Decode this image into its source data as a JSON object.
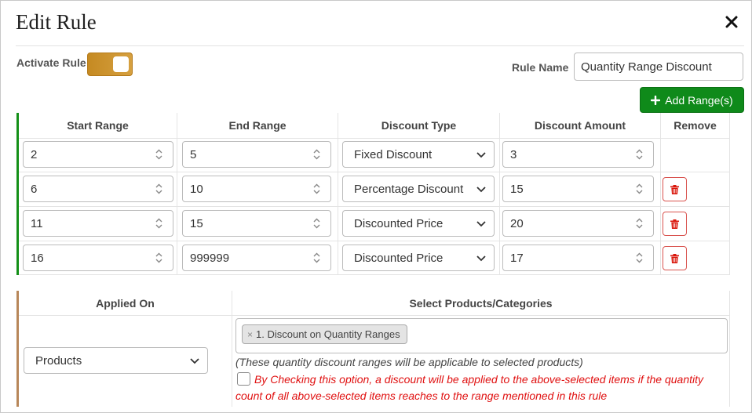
{
  "modal": {
    "title": "Edit Rule"
  },
  "activate": {
    "label": "Activate Rule",
    "enabled": true
  },
  "rule_name": {
    "label": "Rule Name",
    "value": "Quantity Range Discount"
  },
  "add_button": {
    "label": "Add Range(s)",
    "icon": "plus-icon"
  },
  "ranges": {
    "headers": [
      "Start Range",
      "End Range",
      "Discount Type",
      "Discount Amount",
      "Remove"
    ],
    "rows": [
      {
        "start": "2",
        "end": "5",
        "type": "Fixed Discount",
        "amount": "3",
        "removable": false
      },
      {
        "start": "6",
        "end": "10",
        "type": "Percentage Discount",
        "amount": "15",
        "removable": true
      },
      {
        "start": "11",
        "end": "15",
        "type": "Discounted Price",
        "amount": "20",
        "removable": true
      },
      {
        "start": "16",
        "end": "999999",
        "type": "Discounted Price",
        "amount": "17",
        "removable": true
      }
    ]
  },
  "applied": {
    "headers": [
      "Applied On",
      "Select Products/Categories"
    ],
    "applied_on": "Products",
    "selected_items": [
      "1. Discount on Quantity Ranges"
    ],
    "chip_remove": "×",
    "note": "(These quantity discount ranges will be applicable to selected products)",
    "checkbox_text": "By Checking this option, a discount will be applied to the above-selected items if the quantity count of all above-selected items reaches to the range mentioned in this rule",
    "checkbox_checked": false
  },
  "colors": {
    "primary_green": "#0f8a1a",
    "toggle_orange": "#c58a22",
    "ranges_accent": "#149018",
    "applied_accent": "#b8875a",
    "danger": "#d9534f",
    "warning_text": "#e01010"
  }
}
